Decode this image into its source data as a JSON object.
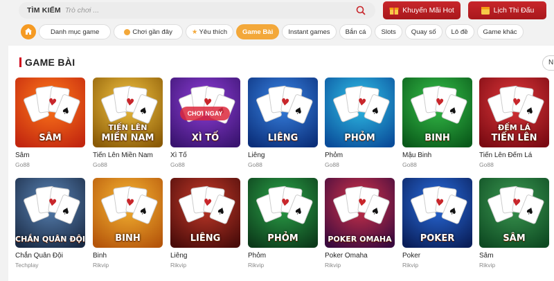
{
  "search": {
    "label": "TÌM KIẾM",
    "placeholder": "Trò chơi ..."
  },
  "header": {
    "promo_label": "Khuyến Mãi Hot",
    "schedule_label": "Lịch Thi Đấu"
  },
  "tabs": [
    {
      "label": "Danh mục game"
    },
    {
      "label": "Chơi gần đây"
    },
    {
      "label": "Yêu thích"
    },
    {
      "label": "Game Bài",
      "active": true
    },
    {
      "label": "Instant games"
    },
    {
      "label": "Bắn cá"
    },
    {
      "label": "Slots"
    },
    {
      "label": "Quay số"
    },
    {
      "label": "Lô đề"
    },
    {
      "label": "Game khác"
    }
  ],
  "section": {
    "title": "GAME BÀI",
    "more_label": "N"
  },
  "games_row1": [
    {
      "name": "Sâm",
      "provider": "Go88",
      "thumb_title": "SÂM",
      "c1": "#ff7a1a",
      "c2": "#c2260f"
    },
    {
      "name": "Tiến Lên Miền Nam",
      "provider": "Go88",
      "thumb_title": "MIỀN NAM",
      "thumb_sub": "TIẾN LÊN",
      "c1": "#f4c542",
      "c2": "#8a5a06"
    },
    {
      "name": "Xì Tố",
      "provider": "Go88",
      "thumb_title": "XÌ TỐ",
      "overlay": "CHƠI NGAY",
      "c1": "#8f3ed8",
      "c2": "#3a1470"
    },
    {
      "name": "Liêng",
      "provider": "Go88",
      "thumb_title": "LIÊNG",
      "c1": "#3a86e6",
      "c2": "#0b2f7a"
    },
    {
      "name": "Phỏm",
      "provider": "Go88",
      "thumb_title": "PHỎM",
      "c1": "#30c2e8",
      "c2": "#0a4d9a"
    },
    {
      "name": "Mậu Binh",
      "provider": "Go88",
      "thumb_title": "BINH",
      "c1": "#36c14a",
      "c2": "#0a5a1a"
    },
    {
      "name": "Tiến Lên Đếm Lá",
      "provider": "Go88",
      "thumb_title": "TIẾN LÊN",
      "thumb_sub": "ĐẾM LÁ",
      "c1": "#e0383b",
      "c2": "#7a0a12"
    }
  ],
  "games_row2": [
    {
      "name": "Chắn Quân Đội",
      "provider": "Techplay",
      "thumb_title": "CHẮN QUÂN ĐỘI",
      "c1": "#5b86b8",
      "c2": "#1a2a44"
    },
    {
      "name": "Binh",
      "provider": "Rikvip",
      "thumb_title": "BINH",
      "c1": "#f7b733",
      "c2": "#b5560b"
    },
    {
      "name": "Liêng",
      "provider": "Rikvip",
      "thumb_title": "LIÊNG",
      "c1": "#c73b2a",
      "c2": "#4a0c0a"
    },
    {
      "name": "Phỏm",
      "provider": "Rikvip",
      "thumb_title": "PHỎM",
      "c1": "#2ca64a",
      "c2": "#0c3a1a"
    },
    {
      "name": "Poker Omaha",
      "provider": "Rikvip",
      "thumb_title": "POKER OMAHA",
      "c1": "#d5344a",
      "c2": "#3a0a3e"
    },
    {
      "name": "Poker",
      "provider": "Rikvip",
      "thumb_title": "POKER",
      "c1": "#2a6ee0",
      "c2": "#0a1f5a"
    },
    {
      "name": "Sâm",
      "provider": "Rikvip",
      "thumb_title": "SÂM",
      "c1": "#3c9a52",
      "c2": "#0e4a22"
    }
  ],
  "colors": {
    "accent": "#f3a83a",
    "brand_red": "#c8262b",
    "section_bar": "#d0021b"
  },
  "icons": {
    "search": "search-icon",
    "gift": "gift-icon",
    "calendar": "calendar-icon",
    "home": "home-icon",
    "clock": "clock-icon",
    "star": "star-icon"
  }
}
